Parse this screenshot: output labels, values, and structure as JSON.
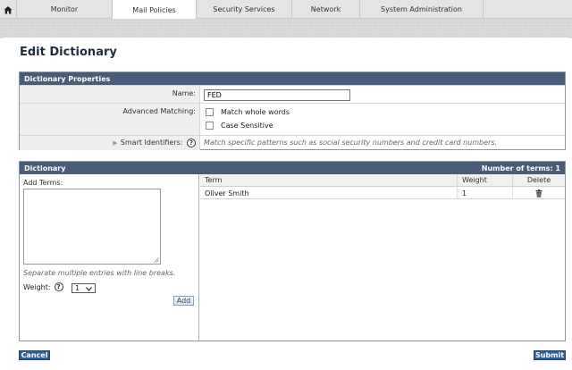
{
  "nav": {
    "tabs": [
      {
        "label": "Monitor"
      },
      {
        "label": "Mail Policies"
      },
      {
        "label": "Security Services"
      },
      {
        "label": "Network"
      },
      {
        "label": "System Administration"
      }
    ],
    "active_tab": "Mail Policies"
  },
  "page": {
    "title": "Edit Dictionary"
  },
  "properties": {
    "header": "Dictionary Properties",
    "name_label": "Name:",
    "name_value": "FED",
    "advanced_label": "Advanced Matching:",
    "match_whole_words": "Match whole words",
    "case_sensitive": "Case Sensitive",
    "smart_label": "Smart Identifiers:",
    "smart_desc": "Match specific patterns such as social security numbers and credit card numbers.",
    "help_glyph": "?"
  },
  "dictionary": {
    "header": "Dictionary",
    "count_label": "Number of terms: 1",
    "add_terms_label": "Add Terms:",
    "hint": "Separate multiple entries with line breaks.",
    "weight_label": "Weight:",
    "weight_value": "1",
    "add_button": "Add",
    "columns": {
      "term": "Term",
      "weight": "Weight",
      "delete": "Delete"
    },
    "rows": [
      {
        "term": "Oliver Smith",
        "weight": "1"
      }
    ]
  },
  "footer": {
    "cancel": "Cancel",
    "submit": "Submit"
  },
  "colors": {
    "header_bar": "#4a5d78",
    "button_blue": "#2e5f9a"
  }
}
